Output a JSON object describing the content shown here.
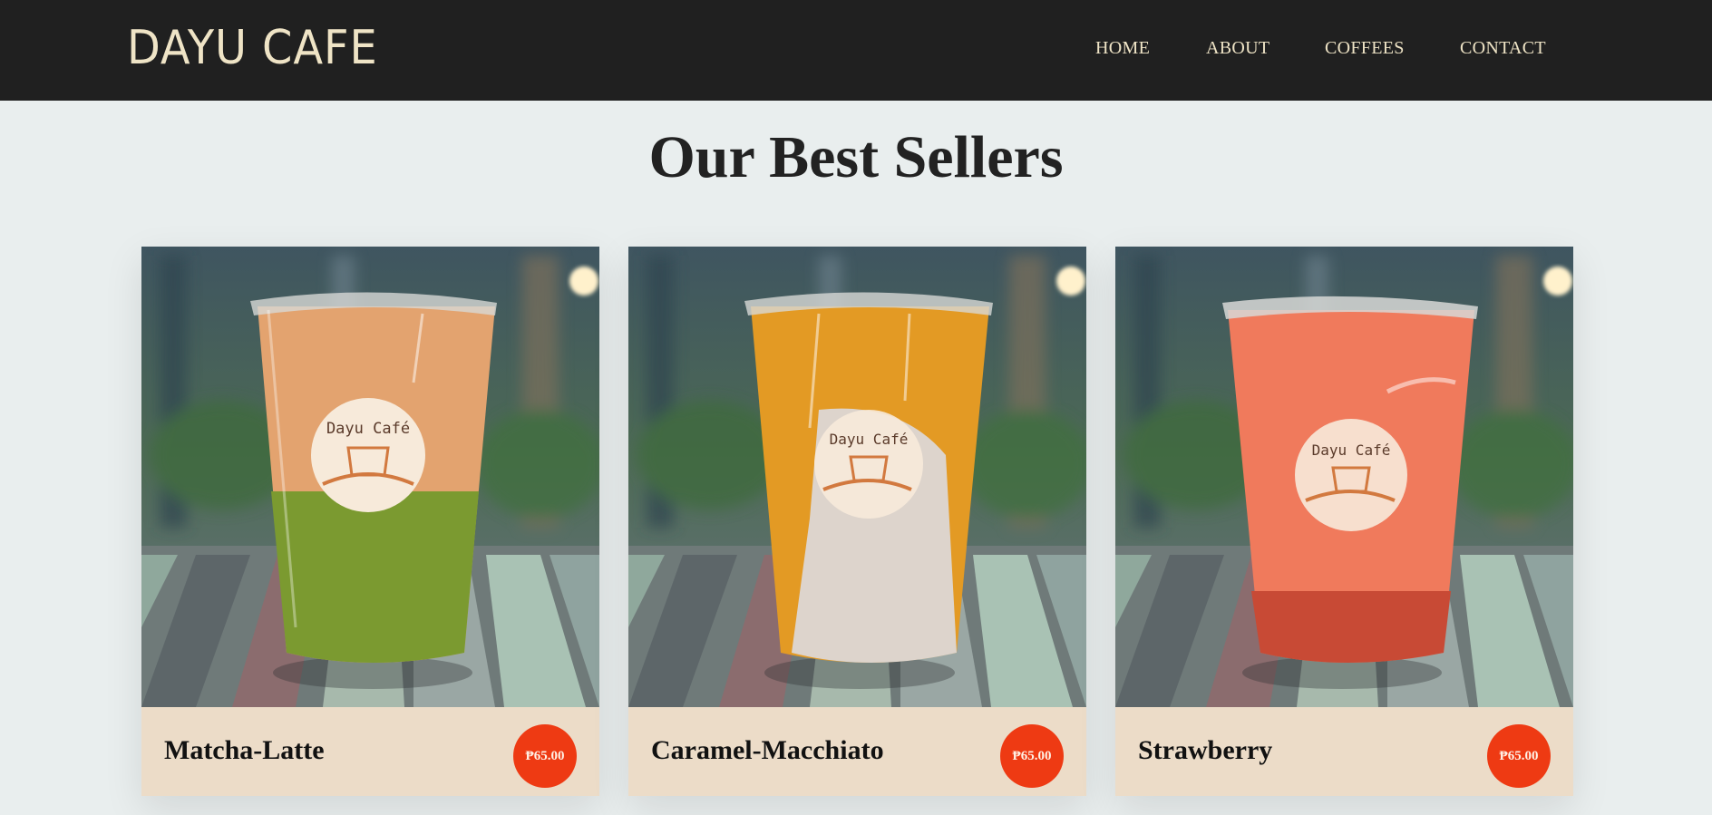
{
  "brand": {
    "name": "DAYU CAFE"
  },
  "nav": {
    "items": [
      {
        "label": "HOME"
      },
      {
        "label": "ABOUT"
      },
      {
        "label": "COFFEES"
      },
      {
        "label": "CONTACT"
      }
    ]
  },
  "section": {
    "title": "Our Best Sellers"
  },
  "products": [
    {
      "name": "Matcha-Latte",
      "price": "₱65.00",
      "cup_label": "Dayu Café",
      "top_color": "#e3a36f",
      "bottom_color": "#7b9a30"
    },
    {
      "name": "Caramel-Macchiato",
      "price": "₱65.00",
      "cup_label": "Dayu Café",
      "top_color": "#e39a24",
      "bottom_color": "#ddd4cc"
    },
    {
      "name": "Strawberry",
      "price": "₱65.00",
      "cup_label": "Dayu Café",
      "top_color": "#f07a5c",
      "bottom_color": "#c84a35"
    }
  ],
  "colors": {
    "navbar": "#202020",
    "brand_text": "#efe4c6",
    "page_background": "#e9eeee",
    "card_footer": "#ecdcc8",
    "price_badge": "#ee3a13"
  }
}
